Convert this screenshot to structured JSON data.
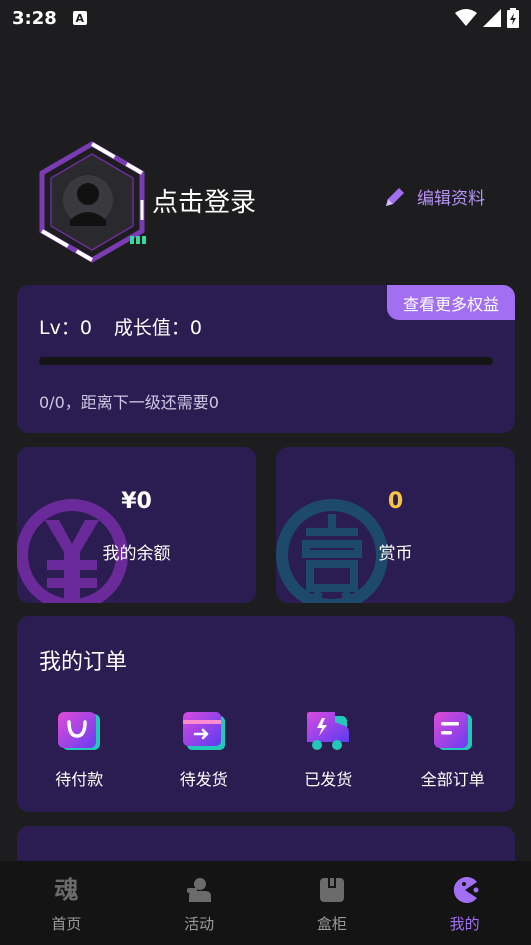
{
  "status": {
    "time": "3:28",
    "notif": "A"
  },
  "profile": {
    "login": "点击登录",
    "edit": "编辑资料"
  },
  "level": {
    "benefits": "查看更多权益",
    "lv_label": "Lv：0",
    "growth_label": "成长值：0",
    "progress": 0,
    "next": "0/0，距离下一级还需要0"
  },
  "wallet": {
    "balance_value": "¥0",
    "balance_label": "我的余额",
    "coins_value": "0",
    "coins_label": "赏币",
    "coins_color": "#f5c542"
  },
  "orders": {
    "title": "我的订单",
    "items": [
      {
        "label": "待付款",
        "icon": "shopping-bag-icon"
      },
      {
        "label": "待发货",
        "icon": "box-arrow-icon"
      },
      {
        "label": "已发货",
        "icon": "truck-icon"
      },
      {
        "label": "全部订单",
        "icon": "list-icon"
      }
    ]
  },
  "tabs": [
    {
      "label": "首页",
      "glyph": "魂",
      "icon": "home-icon"
    },
    {
      "label": "活动",
      "icon": "activity-icon"
    },
    {
      "label": "盒柜",
      "icon": "cabinet-icon"
    },
    {
      "label": "我的",
      "icon": "pacman-icon"
    }
  ],
  "accent": "#a26ef2"
}
